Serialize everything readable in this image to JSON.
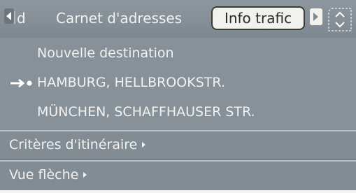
{
  "tabs": {
    "previous_label": "d",
    "address_label": "Carnet d'adresses",
    "active_label": "Info trafic"
  },
  "destinations": [
    {
      "label": "Nouvelle destination",
      "current": false
    },
    {
      "label": "HAMBURG, HELLBROOKSTR.",
      "current": true
    },
    {
      "label": "MÜNCHEN, SCHAFFHAUSER STR.",
      "current": false
    }
  ],
  "menu": {
    "route_criteria": "Critères d'itinéraire",
    "arrow_view": "Vue flèche"
  },
  "colors": {
    "background": "#848e97",
    "text": "#f2f2f0",
    "selected_tab": "#f1f1ed",
    "selected_tab_border": "#3e3a34"
  }
}
